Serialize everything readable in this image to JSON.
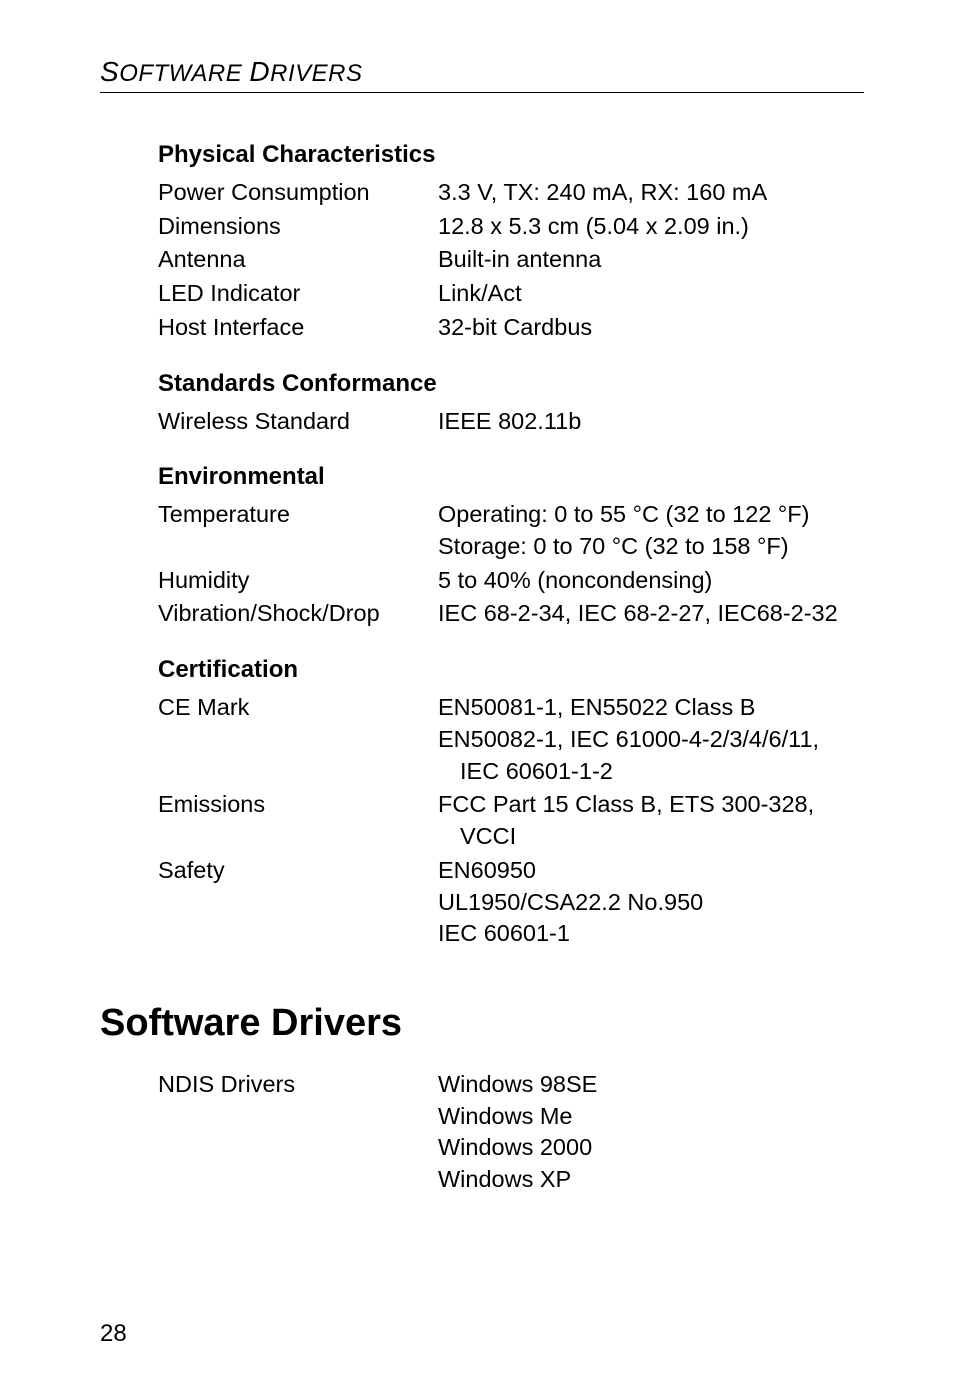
{
  "runningHead": {
    "word1a": "S",
    "word1b": "OFTWARE",
    "word2a": "D",
    "word2b": "RIVERS"
  },
  "sections": {
    "physical": {
      "title": "Physical Characteristics",
      "rows": [
        {
          "label": "Power Consumption",
          "vals": [
            "3.3 V, TX: 240 mA, RX: 160 mA"
          ]
        },
        {
          "label": "Dimensions",
          "vals": [
            "12.8 x 5.3 cm (5.04 x 2.09 in.)"
          ]
        },
        {
          "label": "Antenna",
          "vals": [
            "Built-in antenna"
          ]
        },
        {
          "label": "LED Indicator",
          "vals": [
            "Link/Act"
          ]
        },
        {
          "label": "Host Interface",
          "vals": [
            "32-bit Cardbus"
          ]
        }
      ]
    },
    "standards": {
      "title": "Standards Conformance",
      "rows": [
        {
          "label": "Wireless Standard",
          "vals": [
            "IEEE 802.11b"
          ]
        }
      ]
    },
    "environmental": {
      "title": "Environmental",
      "rows": [
        {
          "label": "Temperature",
          "vals": [
            "Operating: 0 to 55 °C (32 to 122 °F)",
            "Storage: 0 to 70 °C (32 to 158 °F)"
          ]
        },
        {
          "label": "Humidity",
          "vals": [
            "5 to 40% (noncondensing)"
          ]
        },
        {
          "label": "Vibration/Shock/Drop",
          "vals": [
            "IEC 68-2-34, IEC 68-2-27, IEC68-2-32"
          ]
        }
      ]
    },
    "certification": {
      "title": "Certification",
      "rows": [
        {
          "label": "CE Mark",
          "vals": [
            "EN50081-1, EN55022 Class B",
            "EN50082-1, IEC 61000-4-2/3/4/6/11,",
            {
              "indent": true,
              "text": "IEC 60601-1-2"
            }
          ]
        },
        {
          "label": "Emissions",
          "vals": [
            "FCC Part 15 Class B, ETS 300-328,",
            {
              "indent": true,
              "text": "VCCI"
            }
          ]
        },
        {
          "label": "Safety",
          "vals": [
            "EN60950",
            "UL1950/CSA22.2 No.950",
            "IEC 60601-1"
          ]
        }
      ]
    }
  },
  "mainHeading": "Software Drivers",
  "driversRow": {
    "label": "NDIS Drivers",
    "vals": [
      "Windows 98SE",
      "Windows Me",
      "Windows 2000",
      "Windows XP"
    ]
  },
  "pageNumber": "28"
}
